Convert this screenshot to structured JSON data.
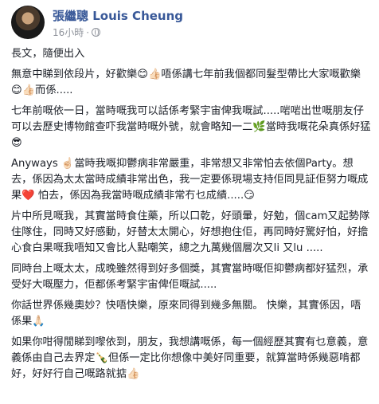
{
  "post": {
    "author": "張繼聰 Louis Cheung",
    "time": "16小時",
    "separator": "·",
    "paragraphs": [
      "長文，隨便出入",
      "無意中睇到依段片，好歡樂😊👍🏻唔係講七年前我個都同髮型帶比大家嘅歡樂😊👍🏻而係.....",
      "七年前嘅依一日，當時嘅我可以話係考緊宇宙俾我嘅試.....啱啱出世嘅朋友仔可以去歷史博物館查吓我當時嘅外號，就會略知一二🌿當時我嘅花朵真係好猛😎",
      "Anyways ☝🏻當時我嘅抑鬱病非常嚴重，非常想又非常怕去依個Party。想去，係因為太太當時成績非常出色，我一定要係現場支持佢同見証佢努力嘅成果❤️ 怕去，係因為我當時嘅成績非常冇乜成績.....😏",
      "片中所見嘅我，其實當時食住藥，所以口乾，好頭暈，好勉，個cam又起勢隊住隊住，同時又好感動，好替太太開心，好想抱住佢，再同時好驚好怕，好擔心食白果嘅我唔知又會比人點嘲笑，總之九萬幾個層次又li 又lu .....",
      "同時台上嘅太太，成晚雖然得到好多個獎，其實當時嘅佢抑鬱病都好猛烈，承受好大嘅壓力，佢都係考緊宇宙俾佢嘅試.....",
      "你話世界係幾奧妙？快唔快樂，原來同得到幾多無關。 快樂，其實係因，唔係果🙏🏻",
      "如果你咁得閒睇到嚟依到，朋友，我想講嘅係，每一個經歷其實有乜意義，意義係由自己去界定🍾但係一定比你想像中美好同重要，就算當時係幾惡啃都好，好好行自己嘅路就掂👍🏻"
    ]
  },
  "icons": {
    "avatar": "profile-photo",
    "privacy": "globe-icon"
  }
}
